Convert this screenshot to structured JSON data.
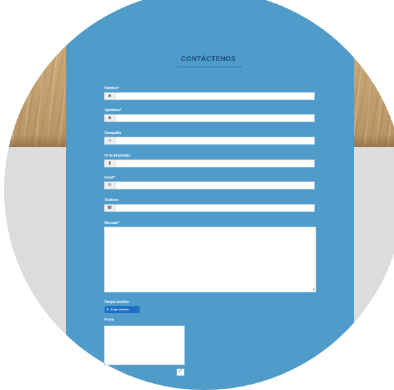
{
  "form": {
    "title": "CONTÁCTENOS",
    "fields": [
      {
        "label": "Nombre*",
        "icon": "user-icon",
        "glyph": "◉",
        "value": ""
      },
      {
        "label": "Apellidos*",
        "icon": "user-icon",
        "glyph": "◉",
        "value": ""
      },
      {
        "label": "Compañía",
        "icon": "building-icon",
        "glyph": "≡",
        "value": ""
      },
      {
        "label": "ID de Empleado",
        "icon": "id-card-icon",
        "glyph": "▮",
        "value": ""
      },
      {
        "label": "Email*",
        "icon": "envelope-icon",
        "glyph": "✉",
        "value": ""
      },
      {
        "label": "Teléfono",
        "icon": "phone-icon",
        "glyph": "☎",
        "value": ""
      }
    ],
    "message_label": "Mensaje*",
    "message_value": "",
    "upload_label": "Cargar archivo",
    "upload_button": "Elegir archivo",
    "upload_icon": "plus-icon",
    "signature_label": "Firma",
    "undo_icon": "undo-icon"
  },
  "colors": {
    "panel": "#4f9ccb",
    "title": "#1c4b78",
    "upload_button": "#1f6fc8"
  }
}
